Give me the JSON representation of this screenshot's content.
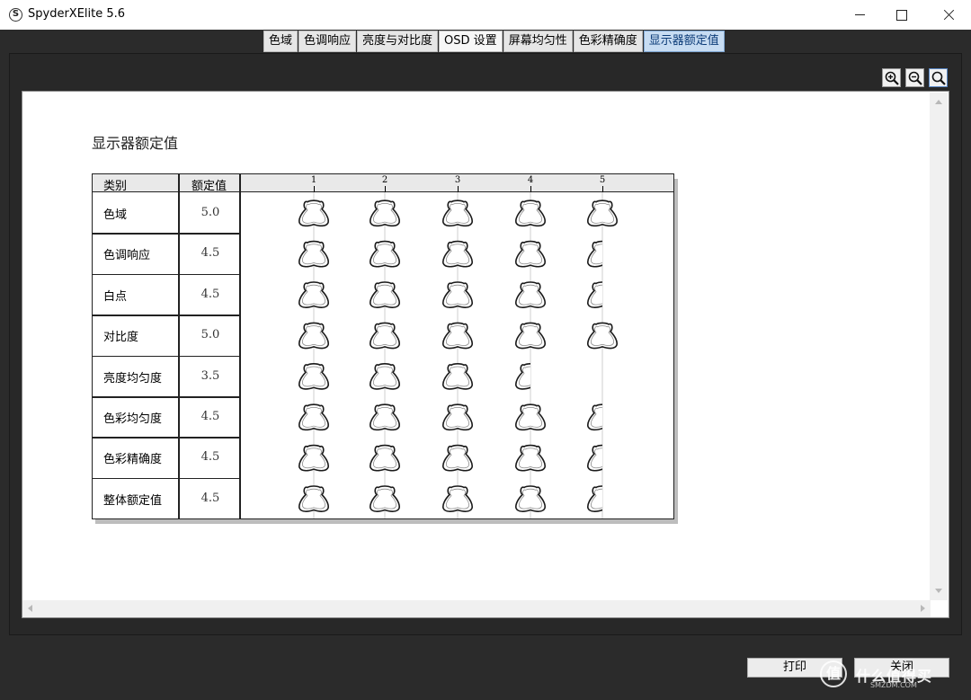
{
  "window": {
    "title": "SpyderXElite 5.6",
    "icon_letter": "S"
  },
  "tabs": [
    {
      "label": "色域",
      "state": "normal"
    },
    {
      "label": "色调响应",
      "state": "normal"
    },
    {
      "label": "亮度与对比度",
      "state": "normal"
    },
    {
      "label": "OSD 设置",
      "state": "active"
    },
    {
      "label": "屏幕均匀性",
      "state": "normal"
    },
    {
      "label": "色彩精确度",
      "state": "normal"
    },
    {
      "label": "显示器额定值",
      "state": "selected"
    }
  ],
  "toolbar": {
    "zoom_in_icon": "zoom-in-icon",
    "zoom_out_icon": "zoom-out-icon",
    "zoom_fit_icon": "zoom-fit-icon"
  },
  "report": {
    "title": "显示器额定值",
    "columns": {
      "category": "类别",
      "rating": "额定值"
    },
    "scale": [
      "1",
      "2",
      "3",
      "4",
      "5"
    ],
    "rows": [
      {
        "category": "色域",
        "rating": "5.0",
        "value": 5.0
      },
      {
        "category": "色调响应",
        "rating": "4.5",
        "value": 4.5
      },
      {
        "category": "白点",
        "rating": "4.5",
        "value": 4.5
      },
      {
        "category": "对比度",
        "rating": "5.0",
        "value": 5.0
      },
      {
        "category": "亮度均匀度",
        "rating": "3.5",
        "value": 3.5
      },
      {
        "category": "色彩均匀度",
        "rating": "4.5",
        "value": 4.5
      },
      {
        "category": "色彩精确度",
        "rating": "4.5",
        "value": 4.5
      },
      {
        "category": "整体额定值",
        "rating": "4.5",
        "value": 4.5
      }
    ],
    "rating_icon": "spyder-sensor-icon"
  },
  "buttons": {
    "print": "打印",
    "close": "关闭"
  },
  "watermark": {
    "badge": "值",
    "text": "什么值得买",
    "sub": "SMZDM.COM"
  }
}
